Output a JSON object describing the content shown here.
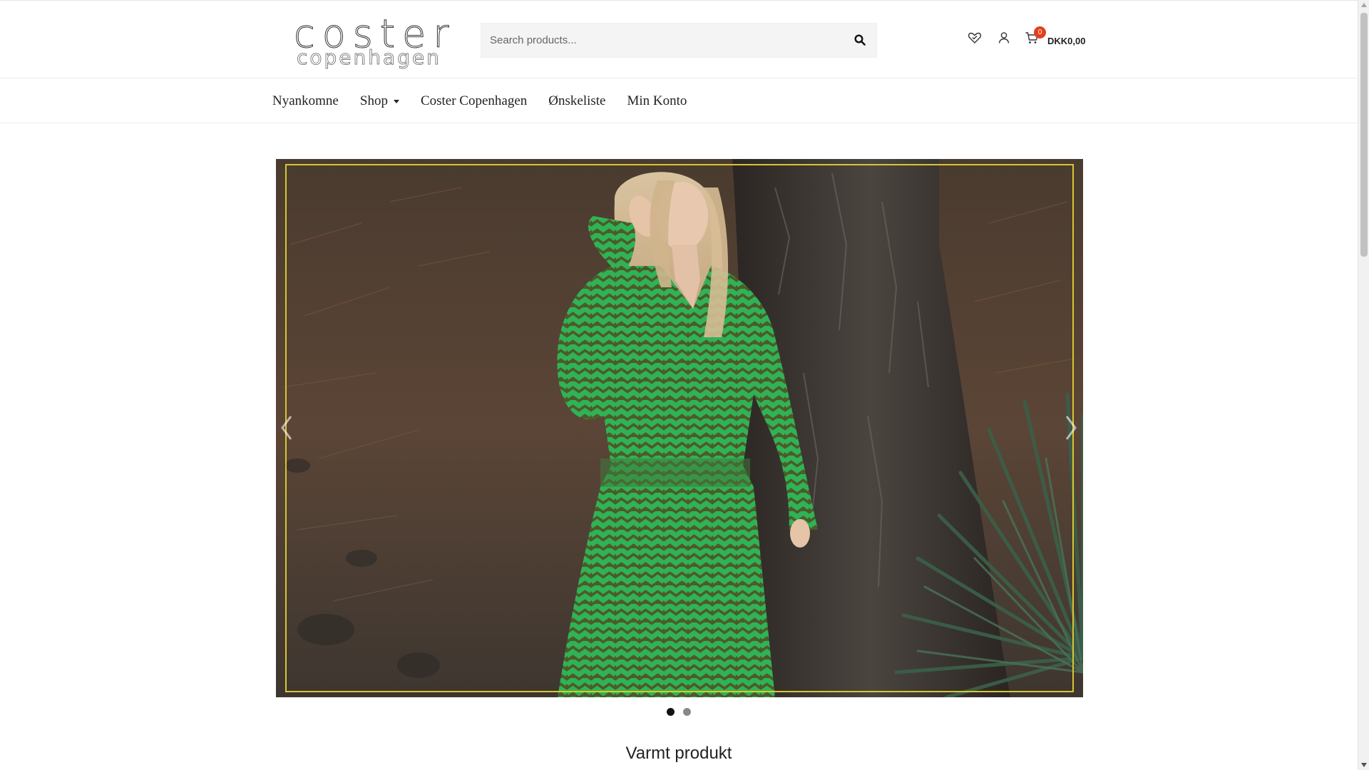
{
  "header": {
    "logo": {
      "line1": "coster",
      "line2": "copenhagen"
    },
    "search": {
      "placeholder": "Search products...",
      "icon": "search-icon"
    },
    "icons": [
      "wishlist-heart-icon",
      "account-user-icon",
      "cart-icon"
    ],
    "cart": {
      "count": "0",
      "total": "DKK0,00"
    }
  },
  "nav": {
    "items": [
      {
        "label": "Nyankomne"
      },
      {
        "label": "Shop",
        "has_dropdown": true
      },
      {
        "label": "Coster Copenhagen"
      },
      {
        "label": "Ønskeliste"
      },
      {
        "label": "Min Konto"
      }
    ]
  },
  "slider": {
    "total_slides": 2,
    "active_slide": 1,
    "frame_color": "#d8c630"
  },
  "section": {
    "title": "Varmt produkt"
  },
  "colors": {
    "accent": "#e2401c",
    "text": "#222222",
    "dress_green": "#2ea84e"
  }
}
